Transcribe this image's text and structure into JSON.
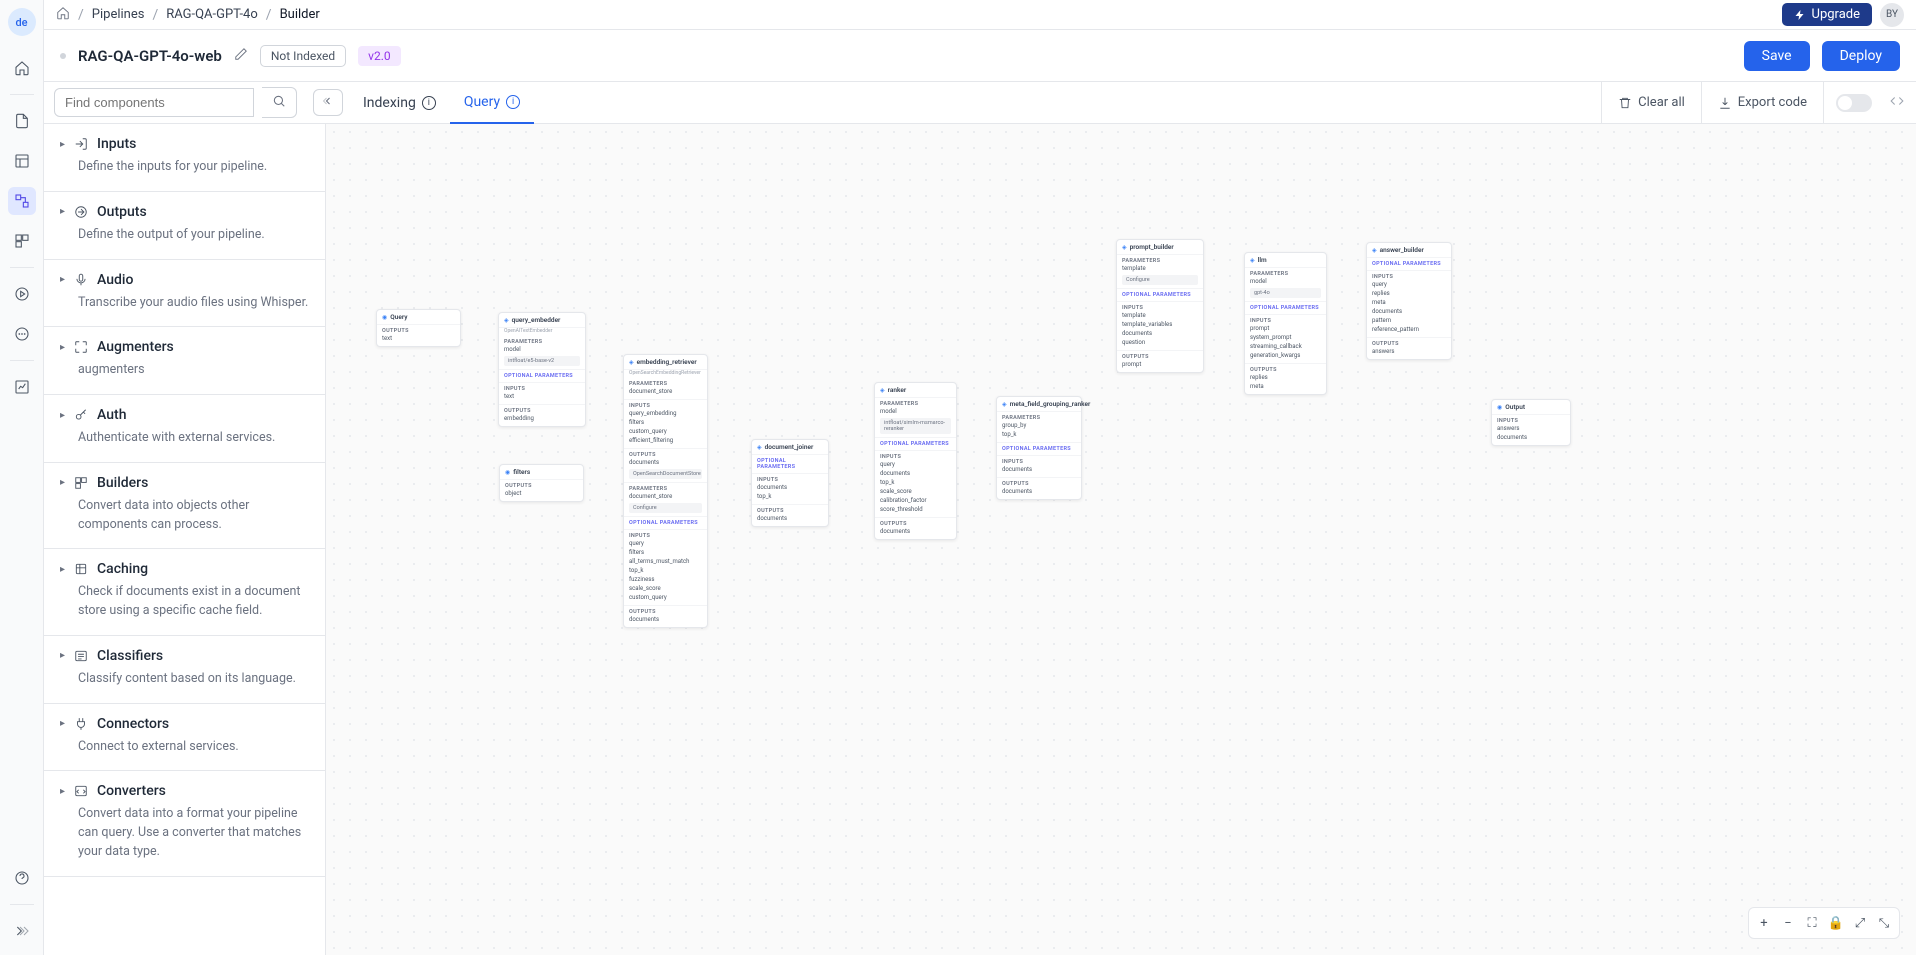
{
  "rail_avatar": "de",
  "breadcrumb": {
    "root": "Pipelines",
    "mid": "RAG-QA-GPT-4o",
    "current": "Builder"
  },
  "upgrade_label": "Upgrade",
  "user_avatar": "BY",
  "pipeline": {
    "name": "RAG-QA-GPT-4o-web",
    "badge_not_indexed": "Not Indexed",
    "version": "v2.0"
  },
  "header_actions": {
    "save": "Save",
    "deploy": "Deploy"
  },
  "toolbar": {
    "search_placeholder": "Find components",
    "tab_indexing": "Indexing",
    "tab_query": "Query",
    "clear_all": "Clear all",
    "export_code": "Export code"
  },
  "component_groups": [
    {
      "name": "Inputs",
      "desc": "Define the inputs for your pipeline.",
      "icon": "login"
    },
    {
      "name": "Outputs",
      "desc": "Define the output of your pipeline.",
      "icon": "logout"
    },
    {
      "name": "Audio",
      "desc": "Transcribe your audio files using Whisper.",
      "icon": "mic"
    },
    {
      "name": "Augmenters",
      "desc": "augmenters",
      "icon": "expand"
    },
    {
      "name": "Auth",
      "desc": "Authenticate with external services.",
      "icon": "key"
    },
    {
      "name": "Builders",
      "desc": "Convert data into objects other components can process.",
      "icon": "blocks"
    },
    {
      "name": "Caching",
      "desc": "Check if documents exist in a document store using a specific cache field.",
      "icon": "cache"
    },
    {
      "name": "Classifiers",
      "desc": "Classify content based on its language.",
      "icon": "list"
    },
    {
      "name": "Connectors",
      "desc": "Connect to external services.",
      "icon": "plug"
    },
    {
      "name": "Converters",
      "desc": "Convert data into a format your pipeline can query. Use a converter that matches your data type.",
      "icon": "convert"
    }
  ],
  "nodes": {
    "query": {
      "title": "Query",
      "outputs_label": "Outputs",
      "outputs": [
        "text"
      ]
    },
    "query_embedder": {
      "title": "query_embedder",
      "subtitle": "OpenAITextEmbedder",
      "params_label": "PARAMETERS",
      "params": [
        {
          "k": "model",
          "v": "intfloat/e5-base-v2"
        }
      ],
      "opt_label": "OPTIONAL PARAMETERS",
      "inputs_label": "Inputs",
      "inputs": [
        "text"
      ],
      "outputs_label": "Outputs",
      "outputs": [
        "embedding"
      ]
    },
    "filters": {
      "title": "filters",
      "outputs_label": "Outputs",
      "outputs": [
        "object"
      ]
    },
    "embedding_retriever": {
      "title": "embedding_retriever",
      "subtitle": "OpenSearchEmbeddingRetriever",
      "params_label": "PARAMETERS",
      "params": [
        {
          "k": "document_store"
        }
      ],
      "inputs_label": "Inputs",
      "inputs": [
        "query_embedding",
        "filters",
        "custom_query",
        "efficient_filtering"
      ],
      "outputs_label": "Outputs",
      "outputs": [
        "documents"
      ],
      "sub_params": [
        {
          "k": "document_store",
          "v": "Configure"
        }
      ],
      "opt_label": "OPTIONAL PARAMETERS",
      "sub_inputs": [
        "query",
        "filters",
        "all_terms_must_match",
        "top_k",
        "fuzziness",
        "scale_score",
        "custom_query"
      ],
      "sub_outputs": [
        "documents"
      ]
    },
    "document_joiner": {
      "title": "document_joiner",
      "opt_label": "OPTIONAL PARAMETERS",
      "inputs_label": "Inputs",
      "inputs": [
        "documents",
        "top_k"
      ],
      "outputs_label": "Outputs",
      "outputs": [
        "documents"
      ]
    },
    "ranker": {
      "title": "ranker",
      "params_label": "PARAMETERS",
      "params": [
        {
          "k": "model",
          "v": "intfloat/simlm-msmarco-reranker"
        }
      ],
      "opt_label": "OPTIONAL PARAMETERS",
      "inputs_label": "Inputs",
      "inputs": [
        "query",
        "documents",
        "top_k",
        "scale_score",
        "calibration_factor",
        "score_threshold"
      ],
      "outputs_label": "Outputs",
      "outputs": [
        "documents"
      ]
    },
    "meta_field_ranker": {
      "title": "meta_field_grouping_ranker",
      "params_label": "PARAMETERS",
      "params": [
        {
          "k": "group_by"
        },
        {
          "k": "top_k"
        }
      ],
      "opt_label": "OPTIONAL PARAMETERS",
      "inputs_label": "Inputs",
      "inputs": [
        "documents"
      ],
      "outputs_label": "Outputs",
      "outputs": [
        "documents"
      ]
    },
    "prompt_builder": {
      "title": "prompt_builder",
      "params_label": "PARAMETERS",
      "params": [
        {
          "k": "template",
          "v": "Configure"
        }
      ],
      "opt_label": "OPTIONAL PARAMETERS",
      "inputs_label": "Inputs",
      "inputs": [
        "template",
        "template_variables",
        "documents",
        "question"
      ],
      "outputs_label": "Outputs",
      "outputs": [
        "prompt"
      ]
    },
    "llm": {
      "title": "llm",
      "params_label": "PARAMETERS",
      "params": [
        {
          "k": "model",
          "v": "gpt-4o"
        }
      ],
      "opt_label": "OPTIONAL PARAMETERS",
      "inputs_label": "Inputs",
      "inputs": [
        "prompt",
        "system_prompt",
        "streaming_callback",
        "generation_kwargs"
      ],
      "outputs_label": "Outputs",
      "outputs": [
        "replies",
        "meta"
      ]
    },
    "answer_builder": {
      "title": "answer_builder",
      "opt_label": "OPTIONAL PARAMETERS",
      "inputs_label": "Inputs",
      "inputs": [
        "query",
        "replies",
        "meta",
        "documents",
        "pattern",
        "reference_pattern"
      ],
      "outputs_label": "Outputs",
      "outputs": [
        "answers"
      ]
    },
    "output": {
      "title": "Output",
      "inputs_label": "Inputs",
      "inputs": [
        "answers",
        "documents"
      ]
    }
  }
}
